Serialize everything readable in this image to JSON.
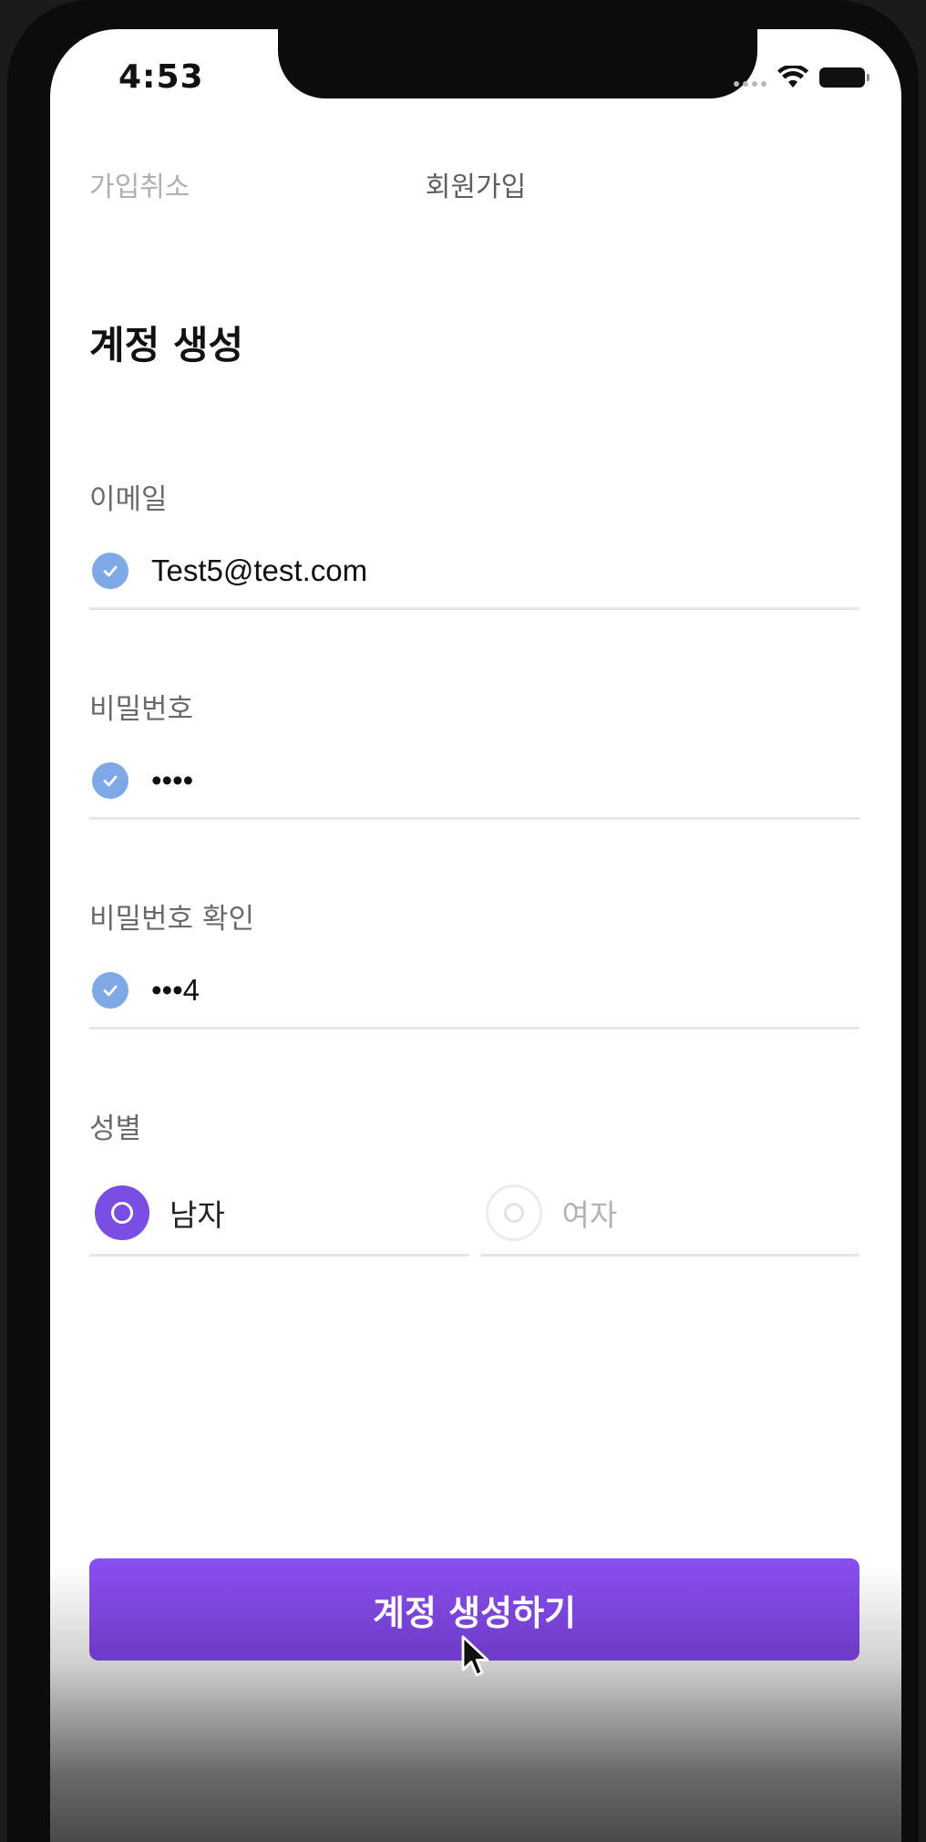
{
  "status_bar": {
    "time": "4:53"
  },
  "nav": {
    "cancel_label": "가입취소",
    "title": "회원가입"
  },
  "section_title": "계정 생성",
  "fields": {
    "email": {
      "label": "이메일",
      "value": "Test5@test.com",
      "status_icon": "check-circle-icon"
    },
    "password": {
      "label": "비밀번호",
      "value": "••••",
      "status_icon": "check-circle-icon"
    },
    "password_confirm": {
      "label": "비밀번호 확인",
      "value": "•••4",
      "status_icon": "check-circle-icon"
    }
  },
  "gender": {
    "label": "성별",
    "options": [
      {
        "label": "남자",
        "selected": true
      },
      {
        "label": "여자",
        "selected": false
      }
    ]
  },
  "submit_button": {
    "label": "계정 생성하기"
  },
  "colors": {
    "accent": "#7a4ee2",
    "check": "#7ea9e6",
    "button_top": "#8a4ff0",
    "button_bottom": "#6d3bc6"
  }
}
